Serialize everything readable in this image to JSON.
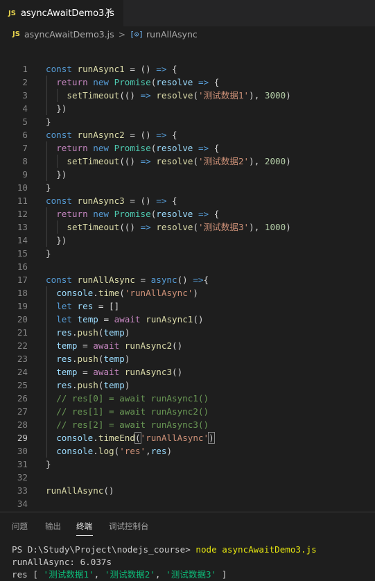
{
  "tab": {
    "badge": "JS",
    "title": "asyncAwaitDemo3.js",
    "close_glyph": "✕"
  },
  "breadcrumb": {
    "badge": "JS",
    "file": "asyncAwaitDemo3.js",
    "separator": ">",
    "symbol_glyph": "[⊙]",
    "symbol": "runAllAsync"
  },
  "editor": {
    "active_line": 29,
    "lines": [
      {
        "n": "1",
        "i": 0,
        "t": [
          [
            "kw",
            "const "
          ],
          [
            "fn",
            "runAsync1"
          ],
          [
            "pun",
            " = () "
          ],
          [
            "kw",
            "=>"
          ],
          [
            "pun",
            " {"
          ]
        ]
      },
      {
        "n": "2",
        "i": 1,
        "t": [
          [
            "ctl",
            "return "
          ],
          [
            "kw",
            "new "
          ],
          [
            "cls",
            "Promise"
          ],
          [
            "pun",
            "("
          ],
          [
            "var",
            "resolve"
          ],
          [
            "pun",
            " "
          ],
          [
            "kw",
            "=>"
          ],
          [
            "pun",
            " {"
          ]
        ]
      },
      {
        "n": "3",
        "i": 2,
        "t": [
          [
            "fn",
            "setTimeout"
          ],
          [
            "pun",
            "(() "
          ],
          [
            "kw",
            "=>"
          ],
          [
            "pun",
            " "
          ],
          [
            "fn",
            "resolve"
          ],
          [
            "pun",
            "("
          ],
          [
            "str",
            "'测试数据1'"
          ],
          [
            "pun",
            "), "
          ],
          [
            "num",
            "3000"
          ],
          [
            "pun",
            ")"
          ]
        ]
      },
      {
        "n": "4",
        "i": 1,
        "t": [
          [
            "pun",
            "})"
          ]
        ]
      },
      {
        "n": "5",
        "i": 0,
        "t": [
          [
            "pun",
            "}"
          ]
        ]
      },
      {
        "n": "6",
        "i": 0,
        "t": [
          [
            "kw",
            "const "
          ],
          [
            "fn",
            "runAsync2"
          ],
          [
            "pun",
            " = () "
          ],
          [
            "kw",
            "=>"
          ],
          [
            "pun",
            " {"
          ]
        ]
      },
      {
        "n": "7",
        "i": 1,
        "t": [
          [
            "ctl",
            "return "
          ],
          [
            "kw",
            "new "
          ],
          [
            "cls",
            "Promise"
          ],
          [
            "pun",
            "("
          ],
          [
            "var",
            "resolve"
          ],
          [
            "pun",
            " "
          ],
          [
            "kw",
            "=>"
          ],
          [
            "pun",
            " {"
          ]
        ]
      },
      {
        "n": "8",
        "i": 2,
        "t": [
          [
            "fn",
            "setTimeout"
          ],
          [
            "pun",
            "(() "
          ],
          [
            "kw",
            "=>"
          ],
          [
            "pun",
            " "
          ],
          [
            "fn",
            "resolve"
          ],
          [
            "pun",
            "("
          ],
          [
            "str",
            "'测试数据2'"
          ],
          [
            "pun",
            "), "
          ],
          [
            "num",
            "2000"
          ],
          [
            "pun",
            ")"
          ]
        ]
      },
      {
        "n": "9",
        "i": 1,
        "t": [
          [
            "pun",
            "})"
          ]
        ]
      },
      {
        "n": "10",
        "i": 0,
        "t": [
          [
            "pun",
            "}"
          ]
        ]
      },
      {
        "n": "11",
        "i": 0,
        "t": [
          [
            "kw",
            "const "
          ],
          [
            "fn",
            "runAsync3"
          ],
          [
            "pun",
            " = () "
          ],
          [
            "kw",
            "=>"
          ],
          [
            "pun",
            " {"
          ]
        ]
      },
      {
        "n": "12",
        "i": 1,
        "t": [
          [
            "ctl",
            "return "
          ],
          [
            "kw",
            "new "
          ],
          [
            "cls",
            "Promise"
          ],
          [
            "pun",
            "("
          ],
          [
            "var",
            "resolve"
          ],
          [
            "pun",
            " "
          ],
          [
            "kw",
            "=>"
          ],
          [
            "pun",
            " {"
          ]
        ]
      },
      {
        "n": "13",
        "i": 2,
        "t": [
          [
            "fn",
            "setTimeout"
          ],
          [
            "pun",
            "(() "
          ],
          [
            "kw",
            "=>"
          ],
          [
            "pun",
            " "
          ],
          [
            "fn",
            "resolve"
          ],
          [
            "pun",
            "("
          ],
          [
            "str",
            "'测试数据3'"
          ],
          [
            "pun",
            "), "
          ],
          [
            "num",
            "1000"
          ],
          [
            "pun",
            ")"
          ]
        ]
      },
      {
        "n": "14",
        "i": 1,
        "t": [
          [
            "pun",
            "})"
          ]
        ]
      },
      {
        "n": "15",
        "i": 0,
        "t": [
          [
            "pun",
            "}"
          ]
        ]
      },
      {
        "n": "16",
        "i": 0,
        "t": []
      },
      {
        "n": "17",
        "i": 0,
        "t": [
          [
            "kw",
            "const "
          ],
          [
            "fn",
            "runAllAsync"
          ],
          [
            "pun",
            " = "
          ],
          [
            "kw",
            "async"
          ],
          [
            "pun",
            "() "
          ],
          [
            "kw",
            "=>"
          ],
          [
            "pun",
            "{"
          ]
        ]
      },
      {
        "n": "18",
        "i": 1,
        "t": [
          [
            "var",
            "console"
          ],
          [
            "pun",
            "."
          ],
          [
            "fn",
            "time"
          ],
          [
            "pun",
            "("
          ],
          [
            "str",
            "'runAllAsync'"
          ],
          [
            "pun",
            ")"
          ]
        ]
      },
      {
        "n": "19",
        "i": 1,
        "t": [
          [
            "kw",
            "let "
          ],
          [
            "var",
            "res"
          ],
          [
            "pun",
            " = []"
          ]
        ]
      },
      {
        "n": "20",
        "i": 1,
        "t": [
          [
            "kw",
            "let "
          ],
          [
            "var",
            "temp"
          ],
          [
            "pun",
            " = "
          ],
          [
            "ctl",
            "await "
          ],
          [
            "fn",
            "runAsync1"
          ],
          [
            "pun",
            "()"
          ]
        ]
      },
      {
        "n": "21",
        "i": 1,
        "t": [
          [
            "var",
            "res"
          ],
          [
            "pun",
            "."
          ],
          [
            "fn",
            "push"
          ],
          [
            "pun",
            "("
          ],
          [
            "var",
            "temp"
          ],
          [
            "pun",
            ")"
          ]
        ]
      },
      {
        "n": "22",
        "i": 1,
        "t": [
          [
            "var",
            "temp"
          ],
          [
            "pun",
            " = "
          ],
          [
            "ctl",
            "await "
          ],
          [
            "fn",
            "runAsync2"
          ],
          [
            "pun",
            "()"
          ]
        ]
      },
      {
        "n": "23",
        "i": 1,
        "t": [
          [
            "var",
            "res"
          ],
          [
            "pun",
            "."
          ],
          [
            "fn",
            "push"
          ],
          [
            "pun",
            "("
          ],
          [
            "var",
            "temp"
          ],
          [
            "pun",
            ")"
          ]
        ]
      },
      {
        "n": "24",
        "i": 1,
        "t": [
          [
            "var",
            "temp"
          ],
          [
            "pun",
            " = "
          ],
          [
            "ctl",
            "await "
          ],
          [
            "fn",
            "runAsync3"
          ],
          [
            "pun",
            "()"
          ]
        ]
      },
      {
        "n": "25",
        "i": 1,
        "t": [
          [
            "var",
            "res"
          ],
          [
            "pun",
            "."
          ],
          [
            "fn",
            "push"
          ],
          [
            "pun",
            "("
          ],
          [
            "var",
            "temp"
          ],
          [
            "pun",
            ")"
          ]
        ]
      },
      {
        "n": "26",
        "i": 1,
        "t": [
          [
            "cmt",
            "// res[0] = await runAsync1()"
          ]
        ]
      },
      {
        "n": "27",
        "i": 1,
        "t": [
          [
            "cmt",
            "// res[1] = await runAsync2()"
          ]
        ]
      },
      {
        "n": "28",
        "i": 1,
        "t": [
          [
            "cmt",
            "// res[2] = await runAsync3()"
          ]
        ]
      },
      {
        "n": "29",
        "i": 1,
        "t": [
          [
            "var",
            "console"
          ],
          [
            "pun",
            "."
          ],
          [
            "fn",
            "timeEnd"
          ],
          [
            "brk",
            "("
          ],
          [
            "str",
            "'runAllAsync'"
          ],
          [
            "brk",
            ")"
          ]
        ]
      },
      {
        "n": "30",
        "i": 1,
        "t": [
          [
            "var",
            "console"
          ],
          [
            "pun",
            "."
          ],
          [
            "fn",
            "log"
          ],
          [
            "pun",
            "("
          ],
          [
            "str",
            "'res'"
          ],
          [
            "pun",
            ","
          ],
          [
            "var",
            "res"
          ],
          [
            "pun",
            ")"
          ]
        ]
      },
      {
        "n": "31",
        "i": 0,
        "t": [
          [
            "pun",
            "}"
          ]
        ]
      },
      {
        "n": "32",
        "i": 0,
        "t": []
      },
      {
        "n": "33",
        "i": 0,
        "t": [
          [
            "fn",
            "runAllAsync"
          ],
          [
            "pun",
            "()"
          ]
        ]
      },
      {
        "n": "34",
        "i": 0,
        "t": []
      }
    ]
  },
  "panel": {
    "tabs": [
      {
        "label": "问题",
        "active": false
      },
      {
        "label": "输出",
        "active": false
      },
      {
        "label": "终端",
        "active": true
      },
      {
        "label": "调试控制台",
        "active": false
      }
    ],
    "terminal": {
      "prompt": "PS D:\\Study\\Project\\nodejs_course> ",
      "command": "node asyncAwaitDemo3.js",
      "output_line1": "runAllAsync: 6.037s",
      "res_prefix": "res [ ",
      "res_items": [
        "'测试数据1'",
        "'测试数据2'",
        "'测试数据3'"
      ],
      "res_sep": ", ",
      "res_suffix": " ]"
    }
  }
}
